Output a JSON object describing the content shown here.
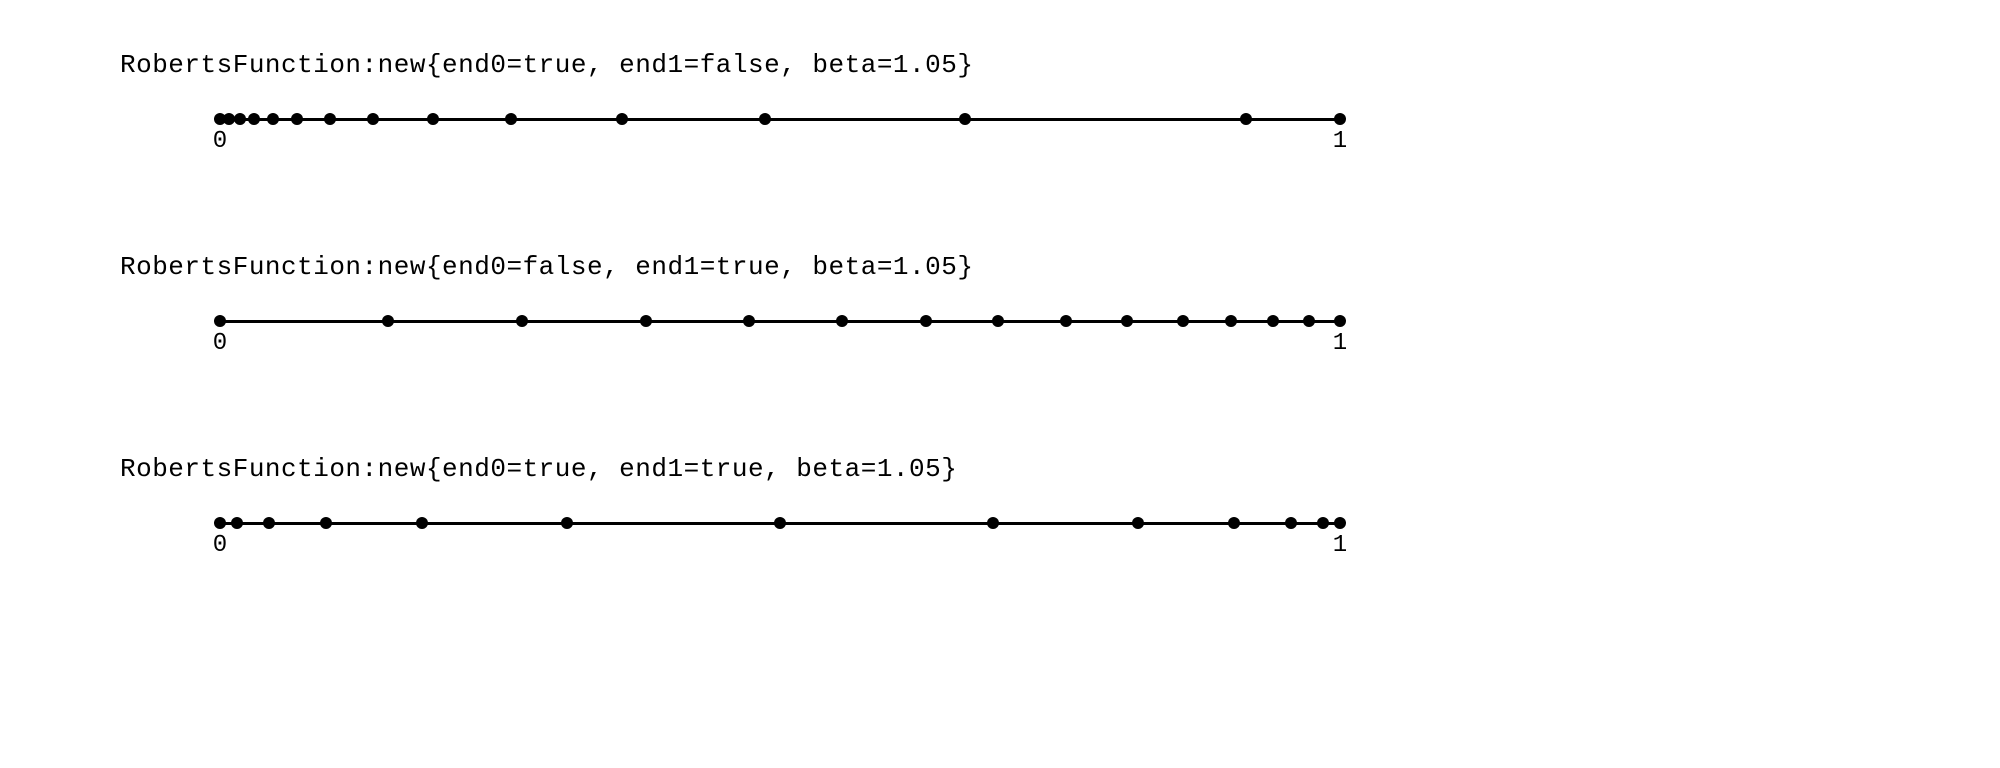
{
  "chart_data": [
    {
      "type": "scatter",
      "title": "RobertsFunction:new{end0=true, end1=false, beta=1.05}",
      "xlabel": "",
      "ylabel": "",
      "xlim": [
        0,
        1
      ],
      "x": [
        0.0,
        0.008,
        0.018,
        0.03,
        0.047,
        0.069,
        0.098,
        0.137,
        0.19,
        0.26,
        0.359,
        0.487,
        0.665,
        0.916,
        1.0
      ],
      "tick_labels": {
        "0": "0",
        "1": "1"
      }
    },
    {
      "type": "scatter",
      "title": "RobertsFunction:new{end0=false, end1=true, beta=1.05}",
      "xlabel": "",
      "ylabel": "",
      "xlim": [
        0,
        1
      ],
      "x": [
        0.0,
        0.15,
        0.27,
        0.38,
        0.472,
        0.555,
        0.63,
        0.695,
        0.755,
        0.81,
        0.86,
        0.903,
        0.94,
        0.972,
        1.0
      ],
      "tick_labels": {
        "0": "0",
        "1": "1"
      }
    },
    {
      "type": "scatter",
      "title": "RobertsFunction:new{end0=true, end1=true, beta=1.05}",
      "xlabel": "",
      "ylabel": "",
      "xlim": [
        0,
        1
      ],
      "x": [
        0.0,
        0.015,
        0.044,
        0.095,
        0.18,
        0.31,
        0.5,
        0.69,
        0.82,
        0.905,
        0.956,
        0.985,
        1.0
      ],
      "tick_labels": {
        "0": "0",
        "1": "1"
      }
    }
  ]
}
